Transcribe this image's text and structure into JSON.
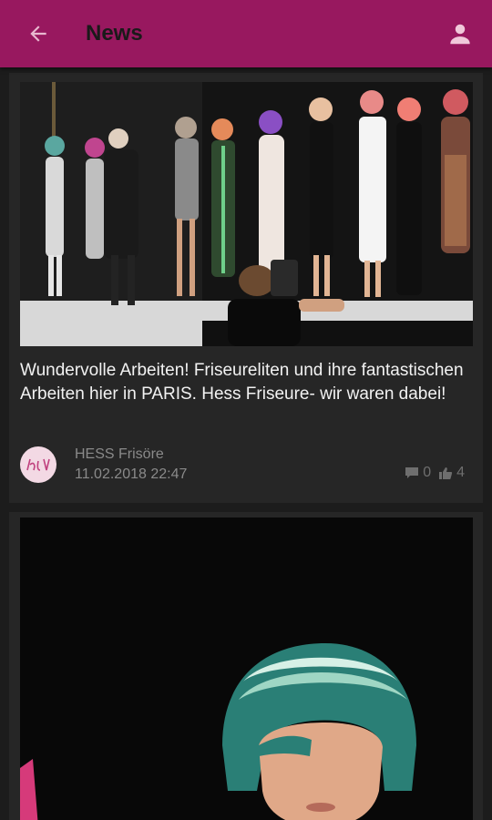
{
  "header": {
    "title": "News"
  },
  "posts": [
    {
      "text": "Wundervolle Arbeiten! Friseureliten und ihre fantastischen Arbeiten hier in PARIS. Hess Friseure- wir waren dabei!",
      "author": "HESS Frisöre",
      "date": "11.02.2018 22:47",
      "comments": "0",
      "likes": "4",
      "image": "runway-show-photo"
    },
    {
      "image": "green-hair-model-photo"
    }
  ],
  "colors": {
    "appbar": "#98185f",
    "background": "#1c1c1c",
    "card": "#262626"
  }
}
